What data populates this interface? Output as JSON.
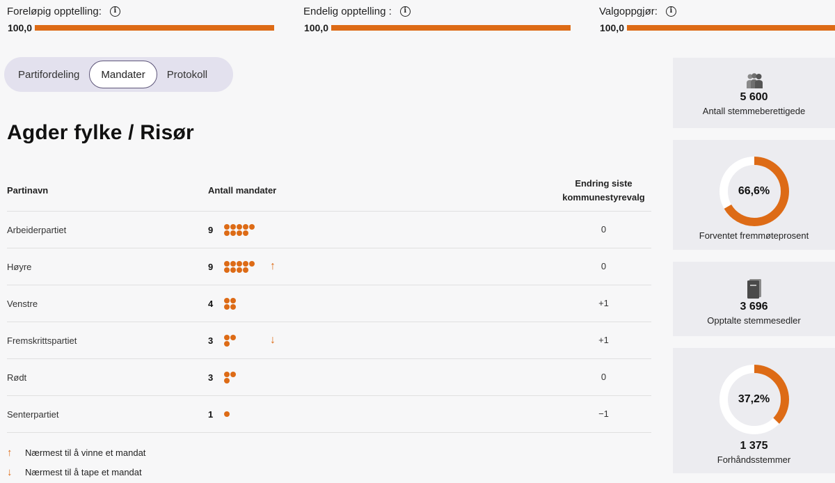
{
  "progress": [
    {
      "label": "Foreløpig opptelling:",
      "value": "100,0",
      "percent": 100
    },
    {
      "label": "Endelig opptelling :",
      "value": "100,0",
      "percent": 100
    },
    {
      "label": "Valgoppgjør:",
      "value": "100,0",
      "percent": 100
    }
  ],
  "tabs": [
    {
      "label": "Partifordeling",
      "active": false
    },
    {
      "label": "Mandater",
      "active": true
    },
    {
      "label": "Protokoll",
      "active": false
    }
  ],
  "title": "Agder fylke / Risør",
  "table": {
    "headers": {
      "name": "Partinavn",
      "seats": "Antall mandater",
      "change": "Endring siste kommunestyrevalg"
    },
    "rows": [
      {
        "party": "Arbeiderpartiet",
        "seats": "9",
        "seat_count": 9,
        "indicator": "",
        "change": "0"
      },
      {
        "party": "Høyre",
        "seats": "9",
        "seat_count": 9,
        "indicator": "up",
        "change": "0"
      },
      {
        "party": "Venstre",
        "seats": "4",
        "seat_count": 4,
        "indicator": "",
        "change": "+1"
      },
      {
        "party": "Fremskrittspartiet",
        "seats": "3",
        "seat_count": 3,
        "indicator": "down",
        "change": "+1"
      },
      {
        "party": "Rødt",
        "seats": "3",
        "seat_count": 3,
        "indicator": "",
        "change": "0"
      },
      {
        "party": "Senterpartiet",
        "seats": "1",
        "seat_count": 1,
        "indicator": "",
        "change": "−1"
      }
    ]
  },
  "legend": {
    "up": "Nærmest til å vinne et mandat",
    "down": "Nærmest til å tape et mandat"
  },
  "cards": {
    "eligible": {
      "value": "5 600",
      "label": "Antall stemmeberettigede",
      "icon": "people-icon"
    },
    "turnout": {
      "value": "66,6%",
      "fraction": 0.666,
      "label": "Forventet fremmøteprosent"
    },
    "counted": {
      "value": "3 696",
      "label": "Opptalte stemmesedler",
      "icon": "ballot-box-icon"
    },
    "advance": {
      "percent": "37,2%",
      "fraction": 0.372,
      "value": "1 375",
      "label": "Forhåndsstemmer"
    }
  },
  "colors": {
    "accent": "#dd6b16",
    "track": "#ffffff",
    "tabs_bg": "#e3e1ee"
  }
}
